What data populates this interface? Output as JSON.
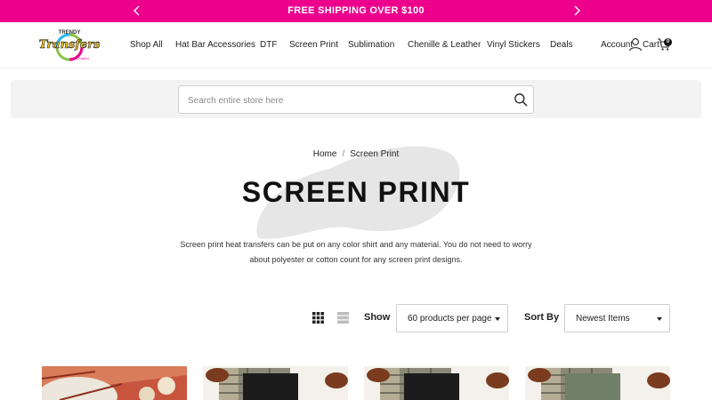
{
  "announcement": {
    "text": "FREE SHIPPING OVER $100",
    "bg_color": "#ec008c"
  },
  "header": {
    "logo": {
      "word": "Transfers",
      "top_word": "TRENDY",
      "sub_word": "with Kashu"
    },
    "nav": [
      "Shop All",
      "Hat Bar Accessories",
      "DTF",
      "Screen Print",
      "Sublimation",
      "Chenille & Leather",
      "Vinyl Stickers",
      "Deals"
    ],
    "account_label": "Account",
    "cart_label": "Cart",
    "cart_count": "0"
  },
  "search": {
    "placeholder": "Search entire store here",
    "value": ""
  },
  "breadcrumb": {
    "home": "Home",
    "separator": "/",
    "current": "Screen Print"
  },
  "page": {
    "title": "SCREEN PRINT",
    "description": "Screen print heat transfers can be put on any color shirt and any material. You do not need to worry about polyester or cotton count for any screen print designs."
  },
  "toolbar": {
    "show_label": "Show",
    "per_page_selected": "60 products per page",
    "sort_label": "Sort By",
    "sort_selected": "Newest Items",
    "view_modes": [
      "grid-view",
      "list-view"
    ]
  },
  "products": [
    {
      "image": "pumpkins-plaid-flatlay"
    },
    {
      "image": "football-plaid-shirt-flatlay"
    },
    {
      "image": "football-plaid-shirt-flatlay"
    },
    {
      "image": "football-plaid-shirt-flatlay"
    }
  ]
}
